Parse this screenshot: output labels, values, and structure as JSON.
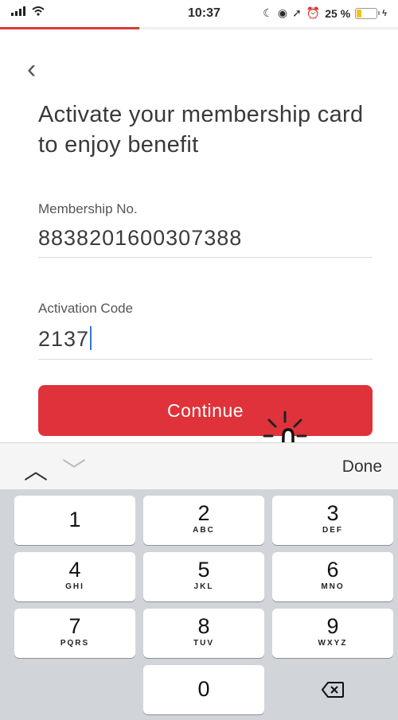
{
  "status_bar": {
    "time": "10:37",
    "battery_percent": "25 %",
    "battery_level": 0.25
  },
  "progress": {
    "fraction": 0.35
  },
  "nav": {
    "back_glyph": "‹"
  },
  "headline": "Activate your membership card to enjoy benefit",
  "membership": {
    "label": "Membership No.",
    "value": "8838201600307388"
  },
  "activation": {
    "label": "Activation Code",
    "value": "2137"
  },
  "continue_label": "Continue",
  "keyboard_toolbar": {
    "done_label": "Done"
  },
  "keypad": {
    "keys": [
      {
        "num": "1",
        "letters": ""
      },
      {
        "num": "2",
        "letters": "ABC"
      },
      {
        "num": "3",
        "letters": "DEF"
      },
      {
        "num": "4",
        "letters": "GHI"
      },
      {
        "num": "5",
        "letters": "JKL"
      },
      {
        "num": "6",
        "letters": "MNO"
      },
      {
        "num": "7",
        "letters": "PQRS"
      },
      {
        "num": "8",
        "letters": "TUV"
      },
      {
        "num": "9",
        "letters": "WXYZ"
      },
      {
        "num": "0",
        "letters": ""
      }
    ]
  },
  "icons": {
    "back": "chevron-left-icon",
    "delete": "backspace-icon",
    "pointer": "tap-hand-icon"
  },
  "colors": {
    "accent": "#e0323a",
    "caret": "#2f78e0",
    "keyboard_bg": "#d1d4d9"
  }
}
